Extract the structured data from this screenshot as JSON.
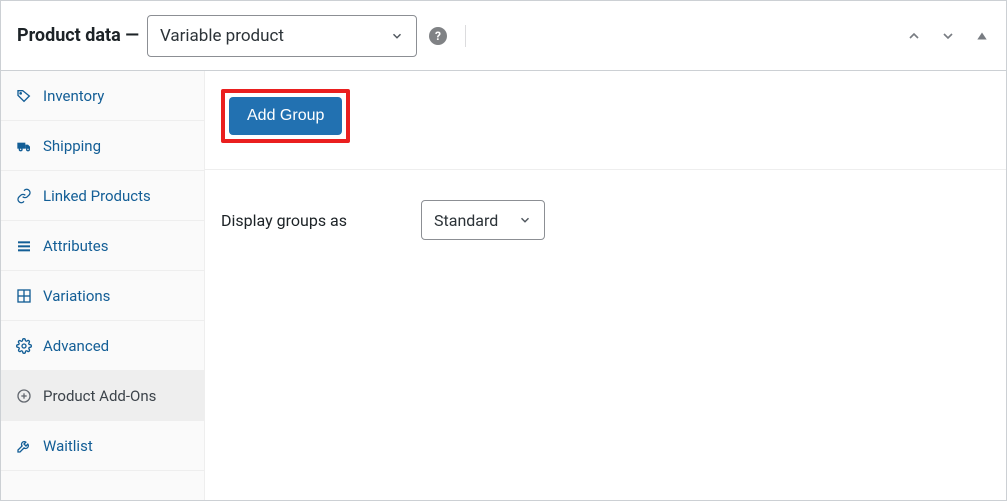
{
  "header": {
    "title": "Product data",
    "dash": "—",
    "product_type": "Variable product"
  },
  "sidebar": {
    "items": [
      {
        "label": "Inventory"
      },
      {
        "label": "Shipping"
      },
      {
        "label": "Linked Products"
      },
      {
        "label": "Attributes"
      },
      {
        "label": "Variations"
      },
      {
        "label": "Advanced"
      },
      {
        "label": "Product Add-Ons"
      },
      {
        "label": "Waitlist"
      }
    ]
  },
  "content": {
    "add_group_label": "Add Group",
    "display_groups_label": "Display groups as",
    "display_groups_value": "Standard"
  }
}
